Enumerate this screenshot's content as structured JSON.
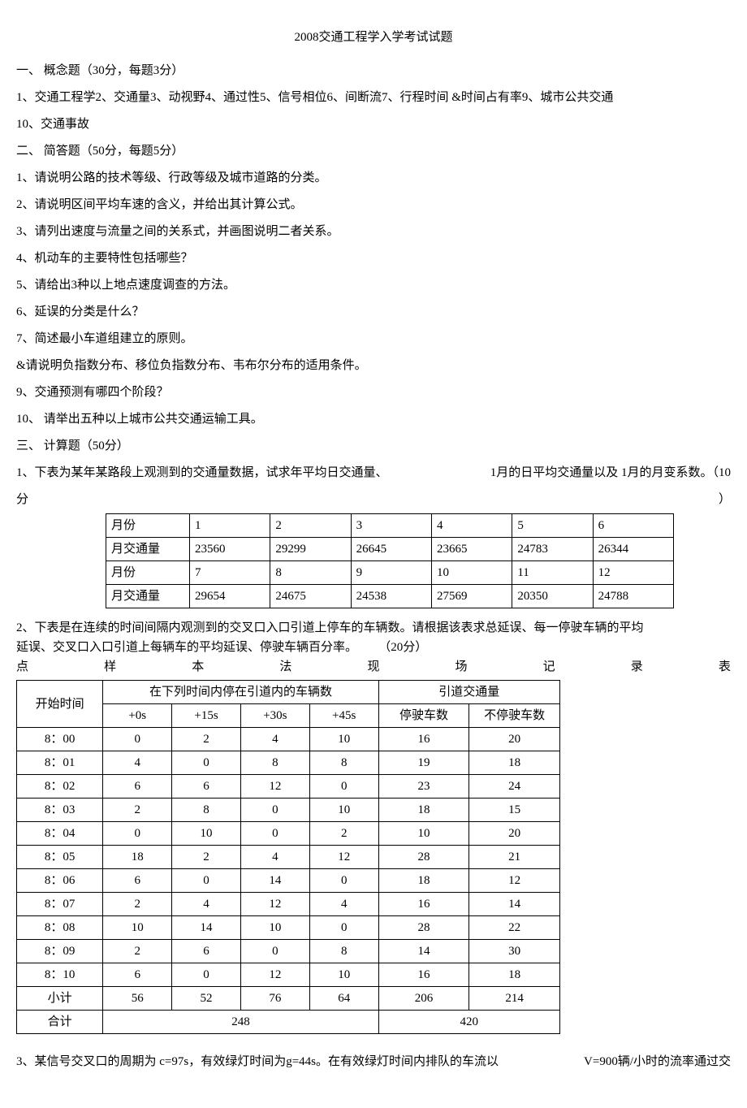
{
  "title": "2008交通工程学入学考试试题",
  "s1_header": "一、 概念题（30分，每题3分）",
  "s1_line1": "1、交通工程学2、交通量3、动视野4、通过性5、信号相位6、间断流7、行程时间 &时间占有率9、城市公共交通",
  "s1_line2": "10、交通事故",
  "s2_header": "二、 简答题（50分，每题5分）",
  "s2_q1": "1、请说明公路的技术等级、行政等级及城市道路的分类。",
  "s2_q2": "2、请说明区间平均车速的含义，并给出其计算公式。",
  "s2_q3": "3、请列出速度与流量之间的关系式，并画图说明二者关系。",
  "s2_q4": "4、机动车的主要特性包括哪些？",
  "s2_q5": "5、请给出3种以上地点速度调查的方法。",
  "s2_q6": "6、延误的分类是什么？",
  "s2_q7": "7、简述最小车道组建立的原则。",
  "s2_q8": "&请说明负指数分布、移位负指数分布、韦布尔分布的适用条件。",
  "s2_q9": "9、交通预测有哪四个阶段？",
  "s2_q10": "10、 请举出五种以上城市公共交通运输工具。",
  "s3_header": "三、 计算题（50分）",
  "s3_q1a": "1、下表为某年某路段上观测到的交通量数据，试求年平均日交通量、",
  "s3_q1b": "1月的日平均交通量以及 1月的月变系数。（10",
  "s3_q1c_l": "分",
  "s3_q1c_r": "）",
  "t1": {
    "r1h": "月份",
    "r1": [
      "1",
      "2",
      "3",
      "4",
      "5",
      "6"
    ],
    "r2h": "月交通量",
    "r2": [
      "23560",
      "29299",
      "26645",
      "23665",
      "24783",
      "26344"
    ],
    "r3h": "月份",
    "r3": [
      "7",
      "8",
      "9",
      "10",
      "11",
      "12"
    ],
    "r4h": "月交通量",
    "r4": [
      "29654",
      "24675",
      "24538",
      "27569",
      "20350",
      "24788"
    ]
  },
  "s3_q2a": "  2、下表是在连续的时间间隔内观测到的交叉口入口引道上停车的车辆数。请根据该表求总延误、每一停驶车辆的平均",
  "s3_q2b_l": "延误、交叉口入口引道上每辆车的平均延误、停驶车辆百分率。",
  "s3_q2b_r": "（20分）",
  "sp": {
    "a": "点",
    "b": "样",
    "c": "本",
    "d": "法",
    "e": "现",
    "f": "场",
    "g": "记",
    "h": "录",
    "i": "表"
  },
  "t2": {
    "h_start": "开始时间",
    "h_group1": "在下列时间内停在引道内的车辆数",
    "h_group2": "引道交通量",
    "h_c1": "+0s",
    "h_c2": "+15s",
    "h_c3": "+30s",
    "h_c4": "+45s",
    "h_c5": "停驶车数",
    "h_c6": "不停驶车数",
    "rows": [
      {
        "t": "8：00",
        "a": "0",
        "b": "2",
        "c": "4",
        "d": "10",
        "e": "16",
        "f": "20"
      },
      {
        "t": "8：01",
        "a": "4",
        "b": "0",
        "c": "8",
        "d": "8",
        "e": "19",
        "f": "18"
      },
      {
        "t": "8：02",
        "a": "6",
        "b": "6",
        "c": "12",
        "d": "0",
        "e": "23",
        "f": "24"
      },
      {
        "t": "8：03",
        "a": "2",
        "b": "8",
        "c": "0",
        "d": "10",
        "e": "18",
        "f": "15"
      },
      {
        "t": "8：04",
        "a": "0",
        "b": "10",
        "c": "0",
        "d": "2",
        "e": "10",
        "f": "20"
      },
      {
        "t": "8：05",
        "a": "18",
        "b": "2",
        "c": "4",
        "d": "12",
        "e": "28",
        "f": "21"
      },
      {
        "t": "8：06",
        "a": "6",
        "b": "0",
        "c": "14",
        "d": "0",
        "e": "18",
        "f": "12"
      },
      {
        "t": "8：07",
        "a": "2",
        "b": "4",
        "c": "12",
        "d": "4",
        "e": "16",
        "f": "14"
      },
      {
        "t": "8：08",
        "a": "10",
        "b": "14",
        "c": "10",
        "d": "0",
        "e": "28",
        "f": "22"
      },
      {
        "t": "8：09",
        "a": "2",
        "b": "6",
        "c": "0",
        "d": "8",
        "e": "14",
        "f": "30"
      },
      {
        "t": "8：10",
        "a": "6",
        "b": "0",
        "c": "12",
        "d": "10",
        "e": "16",
        "f": "18"
      }
    ],
    "sub_label": "小计",
    "sub": {
      "a": "56",
      "b": "52",
      "c": "76",
      "d": "64",
      "e": "206",
      "f": "214"
    },
    "total_label": "合计",
    "total_a": "248",
    "total_b": "420"
  },
  "s3_q3a": "  3、某信号交叉口的周期为 c=97s，有效绿灯时间为g=44s。在有效绿灯时间内排队的车流以",
  "s3_q3b": "V=900辆/小时的流率通过交"
}
